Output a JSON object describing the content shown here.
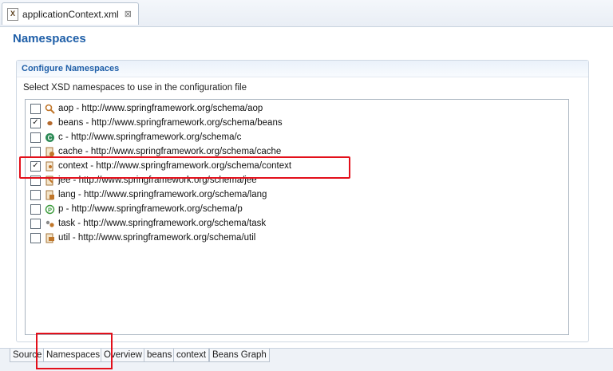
{
  "editor": {
    "tab_title": "applicationContext.xml",
    "tab_close": "⊠",
    "file_icon": "xml-file-icon"
  },
  "page": {
    "title": "Namespaces"
  },
  "section": {
    "title": "Configure Namespaces",
    "description": "Select XSD namespaces to use in the configuration file"
  },
  "namespaces": [
    {
      "label": "aop - http://www.springframework.org/schema/aop",
      "checked": false,
      "icon": "aop-icon"
    },
    {
      "label": "beans - http://www.springframework.org/schema/beans",
      "checked": true,
      "icon": "beans-icon"
    },
    {
      "label": "c - http://www.springframework.org/schema/c",
      "checked": false,
      "icon": "c-namespace-icon"
    },
    {
      "label": "cache - http://www.springframework.org/schema/cache",
      "checked": false,
      "icon": "cache-icon"
    },
    {
      "label": "context - http://www.springframework.org/schema/context",
      "checked": true,
      "icon": "context-icon"
    },
    {
      "label": "jee - http://www.springframework.org/schema/jee",
      "checked": false,
      "icon": "jee-icon"
    },
    {
      "label": "lang - http://www.springframework.org/schema/lang",
      "checked": false,
      "icon": "lang-icon"
    },
    {
      "label": "p - http://www.springframework.org/schema/p",
      "checked": false,
      "icon": "p-namespace-icon"
    },
    {
      "label": "task - http://www.springframework.org/schema/task",
      "checked": false,
      "icon": "task-icon"
    },
    {
      "label": "util - http://www.springframework.org/schema/util",
      "checked": false,
      "icon": "util-icon"
    }
  ],
  "bottom_tabs": [
    {
      "label": "Source",
      "active": false
    },
    {
      "label": "Namespaces",
      "active": true
    },
    {
      "label": "Overview",
      "active": false
    },
    {
      "label": "beans",
      "active": false
    },
    {
      "label": "context",
      "active": false
    },
    {
      "label": "Beans Graph",
      "active": false
    }
  ],
  "colors": {
    "title_blue": "#1f5fa8",
    "highlight_red": "#e3101b"
  }
}
